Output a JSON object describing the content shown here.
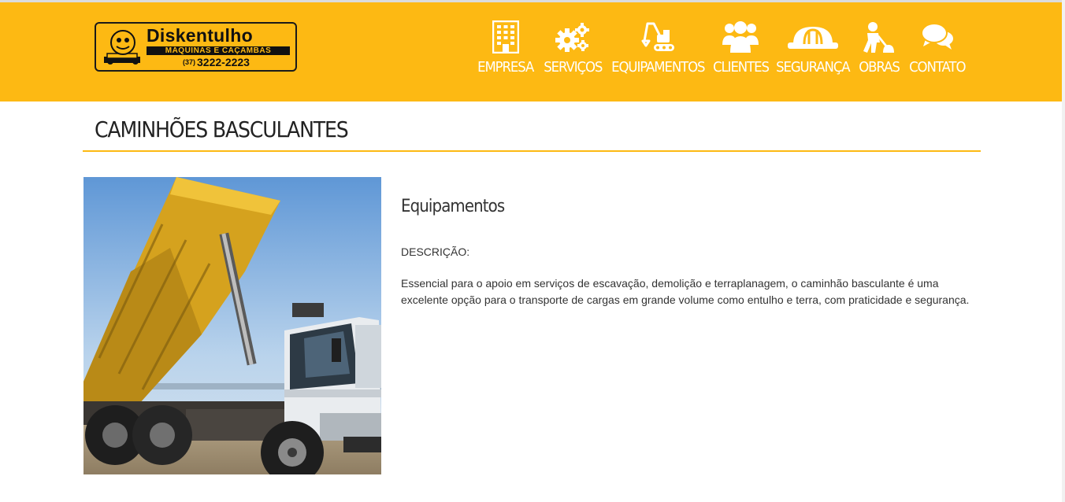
{
  "brand": {
    "name": "Diskentulho",
    "tagline": "MÁQUINAS E CAÇAMBAS",
    "phone_area": "(37)",
    "phone_number": "3222-2223"
  },
  "colors": {
    "accent": "#fdb913",
    "text": "#333333",
    "nav_text": "#ffffff"
  },
  "nav": {
    "items": [
      {
        "label": "EMPRESA",
        "icon": "building-icon"
      },
      {
        "label": "SERVIÇOS",
        "icon": "gears-icon"
      },
      {
        "label": "EQUIPAMENTOS",
        "icon": "excavator-icon"
      },
      {
        "label": "CLIENTES",
        "icon": "users-icon"
      },
      {
        "label": "SEGURANÇA",
        "icon": "hardhat-icon"
      },
      {
        "label": "OBRAS",
        "icon": "worker-icon"
      },
      {
        "label": "CONTATO",
        "icon": "chat-icon"
      }
    ]
  },
  "page": {
    "title": "CAMINHÕES BASCULANTES"
  },
  "equipment": {
    "heading": "Equipamentos",
    "description_label": "DESCRIÇÃO:",
    "description": "Essencial para o apoio em serviços de escavação, demolição e terraplanagem, o caminhão basculante é uma excelente opção para o transporte de cargas em grande volume como entulho e terra, com praticidade e segurança."
  }
}
